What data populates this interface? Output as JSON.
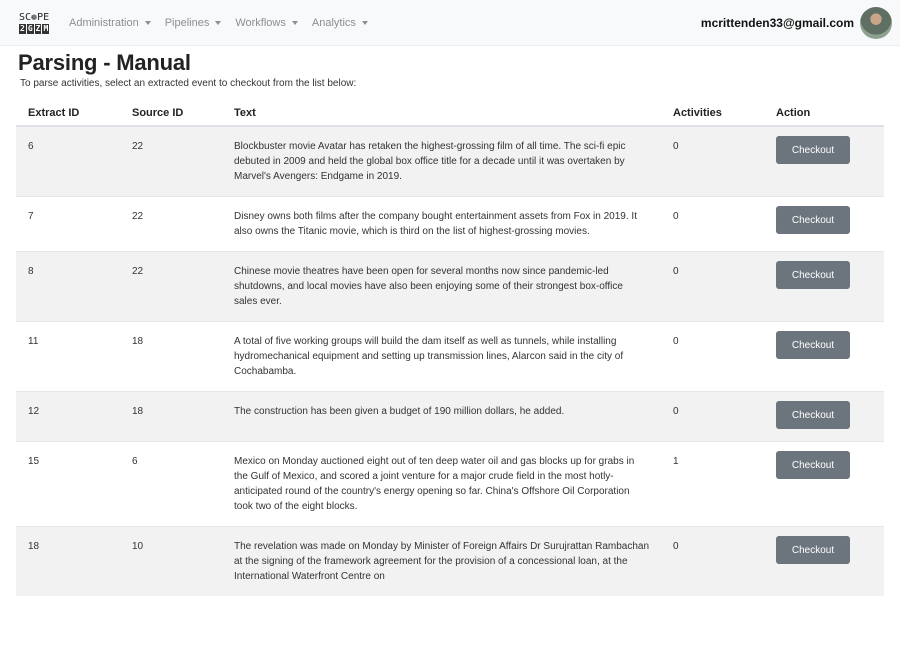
{
  "brand": {
    "line1": "SC",
    "line1_b": "PE",
    "letters": [
      "2",
      "G",
      "Z",
      "M"
    ]
  },
  "nav": [
    {
      "label": "Administration"
    },
    {
      "label": "Pipelines"
    },
    {
      "label": "Workflows"
    },
    {
      "label": "Analytics"
    }
  ],
  "user": {
    "email": "mcrittenden33@gmail.com"
  },
  "page": {
    "title": "Parsing - Manual",
    "subtitle": "To parse activities, select an extracted event to checkout from the list below:"
  },
  "table": {
    "headers": [
      "Extract ID",
      "Source ID",
      "Text",
      "Activities",
      "Action"
    ],
    "rows": [
      {
        "extract_id": "6",
        "source_id": "22",
        "text": "Blockbuster movie Avatar has retaken the highest-grossing film of all time. The sci-fi epic debuted in 2009 and held the global box office title for a decade until it was overtaken by Marvel's Avengers: Endgame in 2019.",
        "activities": "0",
        "action": "Checkout"
      },
      {
        "extract_id": "7",
        "source_id": "22",
        "text": "Disney owns both films after the company bought entertainment assets from Fox in 2019. It also owns the Titanic movie, which is third on the list of highest-grossing movies.",
        "activities": "0",
        "action": "Checkout"
      },
      {
        "extract_id": "8",
        "source_id": "22",
        "text": "Chinese movie theatres have been open for several months now since pandemic-led shutdowns, and local movies have also been enjoying some of their strongest box-office sales ever.",
        "activities": "0",
        "action": "Checkout"
      },
      {
        "extract_id": "11",
        "source_id": "18",
        "text": "A total of five working groups will build the dam itself as well as tunnels, while installing hydromechanical equipment and setting up transmission lines, Alarcon said in the city of Cochabamba.",
        "activities": "0",
        "action": "Checkout"
      },
      {
        "extract_id": "12",
        "source_id": "18",
        "text": "The construction has been given a budget of 190 million dollars, he added.",
        "activities": "0",
        "action": "Checkout"
      },
      {
        "extract_id": "15",
        "source_id": "6",
        "text": "Mexico on Monday auctioned eight out of ten deep water oil and gas blocks up for grabs in the Gulf of Mexico, and scored a joint venture for a major crude field in the most hotly-anticipated round of the country's energy opening so far. China's Offshore Oil Corporation took two of the eight blocks.",
        "activities": "1",
        "action": "Checkout"
      },
      {
        "extract_id": "18",
        "source_id": "10",
        "text": "The revelation was made on Monday by Minister of Foreign Affairs Dr Surujrattan Rambachan at the signing of the framework agreement for the provision of a concessional loan, at the International Waterfront Centre on",
        "activities": "0",
        "action": "Checkout"
      }
    ]
  }
}
